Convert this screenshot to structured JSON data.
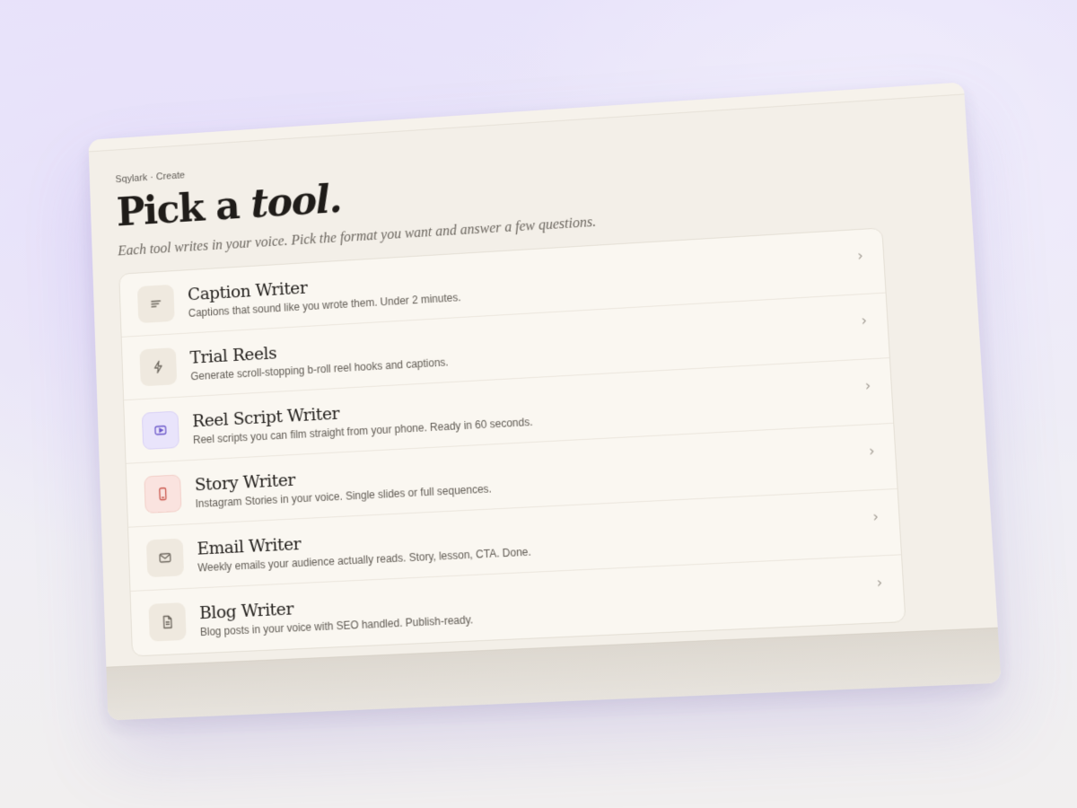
{
  "breadcrumb": "Sqylark · Create",
  "title": {
    "plain": "Pick a ",
    "italic": "tool."
  },
  "subtitle": "Each tool writes in your voice. Pick the format you want and answer a few questions.",
  "tools": [
    {
      "title": "Caption Writer",
      "description": "Captions that sound like you wrote them. Under 2 minutes.",
      "icon": "lines-icon",
      "accent": "#efe9df"
    },
    {
      "title": "Trial Reels",
      "description": "Generate scroll-stopping b-roll reel hooks and captions.",
      "icon": "lightning-icon",
      "accent": "#efe9df"
    },
    {
      "title": "Reel Script Writer",
      "description": "Reel scripts you can film straight from your phone. Ready in 60 seconds.",
      "icon": "play-icon",
      "accent": "#e9e4fb"
    },
    {
      "title": "Story Writer",
      "description": "Instagram Stories in your voice. Single slides or full sequences.",
      "icon": "phone-icon",
      "accent": "#fae3df"
    },
    {
      "title": "Email Writer",
      "description": "Weekly emails your audience actually reads. Story, lesson, CTA. Done.",
      "icon": "envelope-icon",
      "accent": "#efe9df"
    },
    {
      "title": "Blog Writer",
      "description": "Blog posts in your voice with SEO handled. Publish-ready.",
      "icon": "document-icon",
      "accent": "#efe9df"
    }
  ],
  "chevron": "›"
}
